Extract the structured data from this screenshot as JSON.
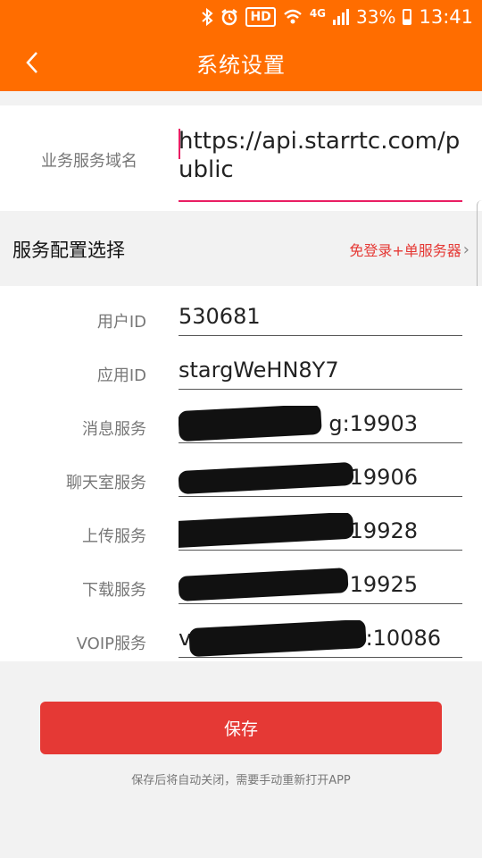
{
  "status_bar": {
    "hd": "HD",
    "network": "4G",
    "battery": "33%",
    "time": "13:41",
    "icons": [
      "bluetooth-icon",
      "alarm-icon",
      "wifi-icon",
      "signal-icon",
      "battery-icon"
    ]
  },
  "header": {
    "title": "系统设置",
    "back_icon": "chevron-left-icon",
    "color": "#ff6d00"
  },
  "domain": {
    "label": "业务服务域名",
    "value": "https://api.starrtc.com/public"
  },
  "config": {
    "title": "服务配置选择",
    "selected": "免登录+单服务器",
    "arrow": "›"
  },
  "fields": [
    {
      "label": "用户ID",
      "value": "530681"
    },
    {
      "label": "应用ID",
      "value": "stargWeHN8Y7"
    },
    {
      "label": "消息服务",
      "value": "g:19903"
    },
    {
      "label": "聊天室服务",
      "value": "19906"
    },
    {
      "label": "上传服务",
      "value": ":19928"
    },
    {
      "label": "下载服务",
      "value": "19925"
    },
    {
      "label": "VOIP服务",
      "value": "v",
      "value_end": ":10086"
    }
  ],
  "save": {
    "label": "保存",
    "hint": "保存后将自动关闭，需要手动重新打开APP",
    "color": "#e53935"
  }
}
